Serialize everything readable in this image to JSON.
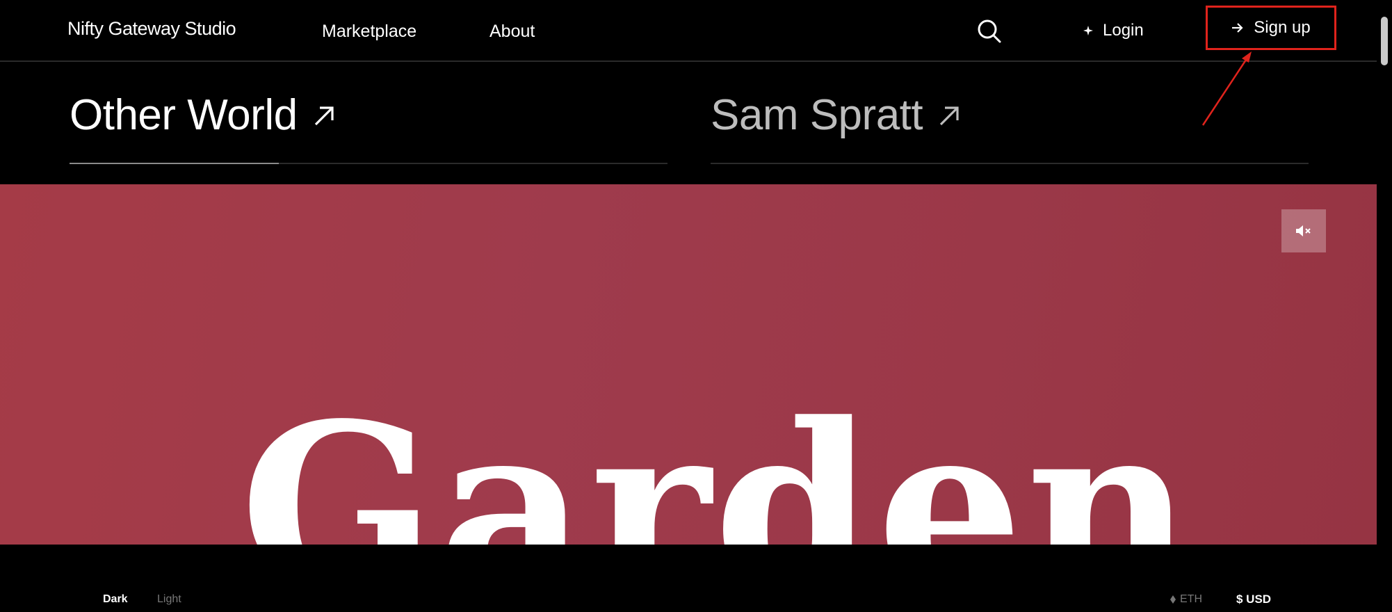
{
  "nav": {
    "brand": "Nifty Gateway Studio",
    "links": [
      {
        "label": "Marketplace"
      },
      {
        "label": "About"
      }
    ],
    "login_label": "Login",
    "signup_label": "Sign up"
  },
  "features": [
    {
      "title": "Other World",
      "active": true,
      "progress": 0.35
    },
    {
      "title": "Sam Spratt",
      "active": false,
      "progress": 0
    }
  ],
  "hero": {
    "background": "#a03b49",
    "word": "Garden"
  },
  "footer": {
    "theme_dark": "Dark",
    "theme_light": "Light",
    "currency_eth": "ETH",
    "currency_usd": "$ USD"
  },
  "colors": {
    "annotation": "#e0231c"
  },
  "icons": [
    "search-icon",
    "login-icon",
    "arrow-right-icon",
    "arrow-up-right-icon",
    "sound-icon",
    "eth-icon"
  ]
}
